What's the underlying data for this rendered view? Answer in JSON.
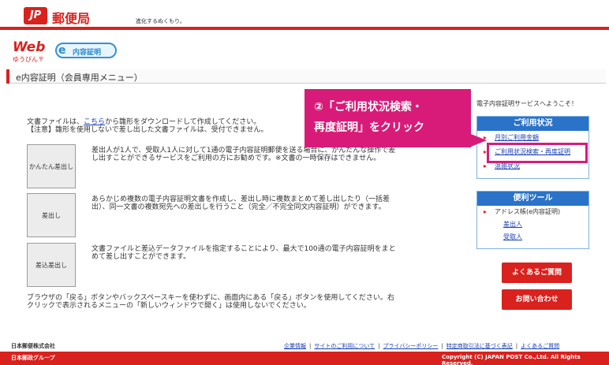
{
  "header": {
    "logo": "JP",
    "brand": "郵便局",
    "tagline": "進化するぬくもり。"
  },
  "subheader": {
    "web_logo": "Web",
    "web_sub": "ゆうびん〒",
    "service_logo_e": "e",
    "service_logo_text": "内容証明"
  },
  "page": {
    "title": "e内容証明（会員専用メニュー）"
  },
  "intro": {
    "line1_before": "文書ファイルは、",
    "line1_link": "こちら",
    "line1_after": "から雛形をダウンロードして作成してください。",
    "line2": "【注意】雛形を使用しないで差し出した文書ファイルは、受付できません。"
  },
  "modes": [
    {
      "label": "かんたん差出し",
      "desc": "差出人が1人で、受取人1人に対して1通の電子内容証明郵便を送る場合に、かんたんな操作で差し出すことができるサービスをご利用の方にお勧めです。※文書の一時保存はできません。"
    },
    {
      "label": "差出し",
      "desc": "あらかじめ複数の電子内容証明文書を作成し、差出し時に複数まとめて差し出したり（一括差出）、同一文書の複数宛先への差出しを行うこと（完全／不完全同文内容証明）ができます。"
    },
    {
      "label": "差込差出し",
      "desc": "文書ファイルと差込データファイルを指定することにより、最大で100通の電子内容証明をまとめて差し出すことができます。"
    }
  ],
  "bottom_note": "ブラウザの「戻る」ボタンやバックスペースキーを使わずに、画面内にある「戻る」ボタンを使用してください。右クリックで表示されるメニューの「新しいウィンドウで開く」は使用しないでください。",
  "sidebar": {
    "welcome": "電子内容証明サービスへようこそ！",
    "usage_panel": {
      "title": "ご利用状況",
      "items": [
        "月別ご利用金額",
        "ご利用状況検索・再度証明",
        "混雑状況"
      ]
    },
    "tools_panel": {
      "title": "便利ツール",
      "address_book": "アドレス帳(e内容証明)",
      "sub_items": [
        "差出人",
        "受取人"
      ]
    },
    "faq_button": "よくあるご質問",
    "contact_button": "お問い合わせ"
  },
  "callout": {
    "line1": "②「ご利用状況検索・",
    "line2": "再度証明」をクリック"
  },
  "footer": {
    "company": "日本郵便株式会社",
    "links": [
      "企業情報",
      "サイトのご利用について",
      "プライバシーポリシー",
      "特定商取引法に基づく表記",
      "よくあるご質問"
    ],
    "group": "日本郵政グループ",
    "copyright": "Copyright (C) JAPAN POST Co.,Ltd. All Rights Reserved."
  },
  "colors": {
    "brand_red": "#d9211d",
    "panel_blue": "#2a73c9",
    "callout_pink": "#d81b78",
    "link_blue": "#1a3fb3"
  }
}
